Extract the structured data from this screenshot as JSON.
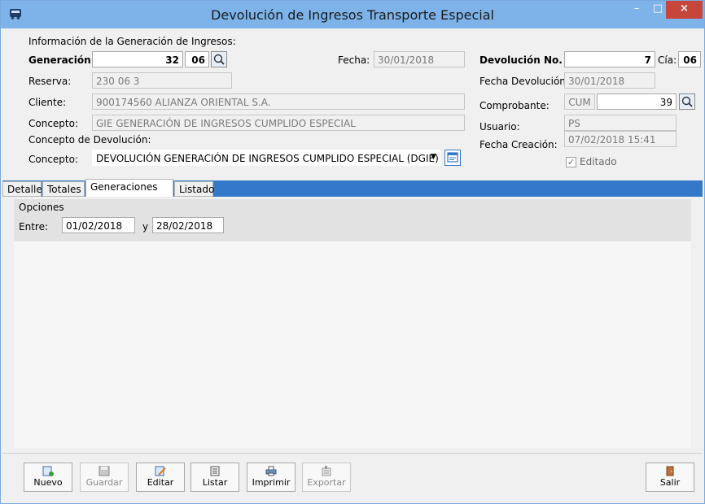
{
  "window": {
    "title": "Devolución de Ingresos Transporte Especial",
    "min_glyph": "–",
    "max_glyph": "□",
    "close_glyph": "×"
  },
  "generation_info": {
    "section_title": "Información de la Generación de Ingresos:",
    "generacion_label": "Generación:",
    "generacion_number": "32",
    "generacion_cia": "06",
    "fecha_label": "Fecha:",
    "fecha_value": "30/01/2018",
    "reserva_label": "Reserva:",
    "reserva_value": "230 06 3",
    "cliente_label": "Cliente:",
    "cliente_value": "900174560 ALIANZA ORIENTAL S.A.",
    "concepto_label": "Concepto:",
    "concepto_value": "GIE GENERACIÓN DE INGRESOS CUMPLIDO ESPECIAL",
    "concepto_devolucion_title": "Concepto de Devolución:",
    "concepto_devolucion_label": "Concepto:",
    "concepto_devolucion_value": "DEVOLUCIÓN GENERACIÓN DE INGRESOS CUMPLIDO ESPECIAL (DGIE)"
  },
  "devolucion": {
    "numero_label": "Devolución No.",
    "numero_value": "7",
    "cia_label": "Cía:",
    "cia_value": "06",
    "fecha_devolucion_label": "Fecha Devolución:",
    "fecha_devolucion_value": "30/01/2018",
    "comprobante_label": "Comprobante:",
    "comprobante_tipo": "CUM",
    "comprobante_numero": "39",
    "usuario_label": "Usuario:",
    "usuario_value": "PS",
    "fecha_creacion_label": "Fecha Creación:",
    "fecha_creacion_value": "07/02/2018 15:41",
    "editado_label": "Editado",
    "editado_checked": true
  },
  "tabs": [
    {
      "label": "Detalle",
      "active": false
    },
    {
      "label": "Totales",
      "active": false
    },
    {
      "label": "Generaciones",
      "active": true
    },
    {
      "label": "Listado",
      "active": false
    }
  ],
  "options": {
    "title": "Opciones",
    "entre_label": "Entre:",
    "fecha_desde": "01/02/2018",
    "y_label": "y",
    "fecha_hasta": "28/02/2018"
  },
  "toolbar": {
    "nuevo": "Nuevo",
    "guardar": "Guardar",
    "editar": "Editar",
    "listar": "Listar",
    "imprimir": "Imprimir",
    "exportar": "Exportar",
    "salir": "Salir"
  },
  "colors": {
    "titlebar": "#7db3e8",
    "tabstrip": "#3479c9",
    "close": "#c7463b"
  }
}
